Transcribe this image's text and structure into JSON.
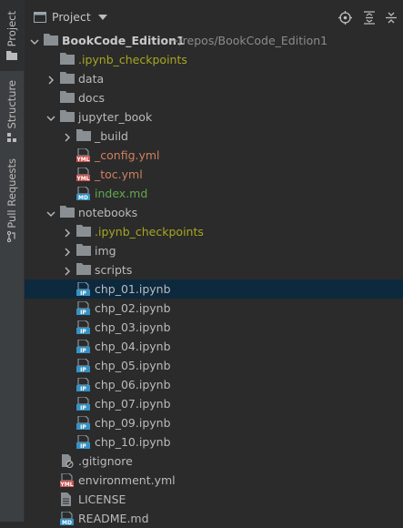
{
  "side_tabs": [
    {
      "label": "Project",
      "icon": "folder-icon"
    },
    {
      "label": "Structure",
      "icon": "structure-icon"
    },
    {
      "label": "Pull Requests",
      "icon": "pull-request-icon"
    }
  ],
  "header": {
    "title": "Project",
    "actions": [
      "locate-icon",
      "expand-all-icon",
      "collapse-all-icon",
      "more-icon"
    ]
  },
  "tree": [
    {
      "depth": 0,
      "chevron": "down",
      "icon": "folder",
      "label": "BookCode_Edition1",
      "path": "~/repos/BookCode_Edition1",
      "style": "bold"
    },
    {
      "depth": 1,
      "chevron": "",
      "icon": "folder",
      "label": ".ipynb_checkpoints",
      "style": "yellow"
    },
    {
      "depth": 1,
      "chevron": "right",
      "icon": "folder",
      "label": "data",
      "style": ""
    },
    {
      "depth": 1,
      "chevron": "",
      "icon": "folder",
      "label": "docs",
      "style": ""
    },
    {
      "depth": 1,
      "chevron": "down",
      "icon": "folder",
      "label": "jupyter_book",
      "style": ""
    },
    {
      "depth": 2,
      "chevron": "right",
      "icon": "folder",
      "label": "_build",
      "style": ""
    },
    {
      "depth": 2,
      "chevron": "",
      "icon": "yml",
      "label": "_config.yml",
      "style": "orange"
    },
    {
      "depth": 2,
      "chevron": "",
      "icon": "yml",
      "label": "_toc.yml",
      "style": "orange"
    },
    {
      "depth": 2,
      "chevron": "",
      "icon": "md",
      "label": "index.md",
      "style": "green"
    },
    {
      "depth": 1,
      "chevron": "down",
      "icon": "folder",
      "label": "notebooks",
      "style": ""
    },
    {
      "depth": 2,
      "chevron": "right",
      "icon": "folder",
      "label": ".ipynb_checkpoints",
      "style": "yellow"
    },
    {
      "depth": 2,
      "chevron": "right",
      "icon": "folder",
      "label": "img",
      "style": ""
    },
    {
      "depth": 2,
      "chevron": "right",
      "icon": "folder",
      "label": "scripts",
      "style": ""
    },
    {
      "depth": 2,
      "chevron": "",
      "icon": "ipynb",
      "label": "chp_01.ipynb",
      "style": "",
      "selected": true
    },
    {
      "depth": 2,
      "chevron": "",
      "icon": "ipynb",
      "label": "chp_02.ipynb",
      "style": ""
    },
    {
      "depth": 2,
      "chevron": "",
      "icon": "ipynb",
      "label": "chp_03.ipynb",
      "style": ""
    },
    {
      "depth": 2,
      "chevron": "",
      "icon": "ipynb",
      "label": "chp_04.ipynb",
      "style": ""
    },
    {
      "depth": 2,
      "chevron": "",
      "icon": "ipynb",
      "label": "chp_05.ipynb",
      "style": ""
    },
    {
      "depth": 2,
      "chevron": "",
      "icon": "ipynb",
      "label": "chp_06.ipynb",
      "style": ""
    },
    {
      "depth": 2,
      "chevron": "",
      "icon": "ipynb",
      "label": "chp_07.ipynb",
      "style": ""
    },
    {
      "depth": 2,
      "chevron": "",
      "icon": "ipynb",
      "label": "chp_09.ipynb",
      "style": ""
    },
    {
      "depth": 2,
      "chevron": "",
      "icon": "ipynb",
      "label": "chp_10.ipynb",
      "style": ""
    },
    {
      "depth": 1,
      "chevron": "",
      "icon": "gitignore",
      "label": ".gitignore",
      "style": ""
    },
    {
      "depth": 1,
      "chevron": "",
      "icon": "yml",
      "label": "environment.yml",
      "style": ""
    },
    {
      "depth": 1,
      "chevron": "",
      "icon": "text",
      "label": "LICENSE",
      "style": ""
    },
    {
      "depth": 1,
      "chevron": "",
      "icon": "md",
      "label": "README.md",
      "style": ""
    }
  ],
  "colors": {
    "background": "#2b2b2b",
    "side_strip": "#3c3f41",
    "selection": "#0d293e",
    "folder": "#8a8f94",
    "ignored": "#a8a621",
    "modified": "#d0805f",
    "added": "#62a84d",
    "notebook": "#3592c4"
  }
}
